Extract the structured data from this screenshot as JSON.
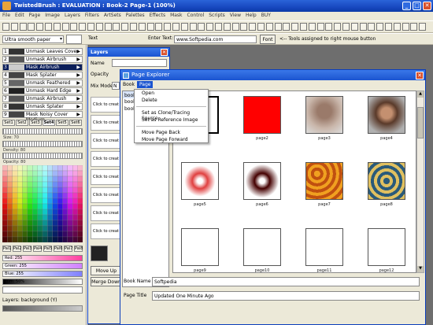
{
  "app": {
    "title": "TwistedBrush : EVALUATION : Book-2 Page-1 (100%)",
    "minimize": "_",
    "maximize": "□",
    "close": "✕"
  },
  "menubar": [
    "File",
    "Edit",
    "Page",
    "Image",
    "Layers",
    "Filters",
    "ArtSets",
    "Palettes",
    "Effects",
    "Mask",
    "Control",
    "Scripts",
    "View",
    "Help",
    "BUY"
  ],
  "toolbar2": {
    "paper": "Ultra smooth paper",
    "text_btn": "Text",
    "enter_text_label": "Enter Text:",
    "enter_text_value": "www.Softpedia.com",
    "font_btn": "Font",
    "hint": "<-- Tools assigned to right mouse button"
  },
  "brushes": [
    {
      "num": "1",
      "label": "Unmask Leaves Cover"
    },
    {
      "num": "2",
      "label": "Unmask Airbrush"
    },
    {
      "num": "3",
      "label": "Mask Airbrush"
    },
    {
      "num": "4",
      "label": "Mask Splater"
    },
    {
      "num": "5",
      "label": "Unmask Feathered"
    },
    {
      "num": "6",
      "label": "Unmask Hard Edge"
    },
    {
      "num": "7",
      "label": "Unmask Airbrush"
    },
    {
      "num": "8",
      "label": "Unmask Splater"
    },
    {
      "num": "9",
      "label": "Mask Noisy Cover Medium"
    }
  ],
  "sets": [
    "Set1",
    "Set2",
    "Set3",
    "Set4",
    "Set5",
    "Set6"
  ],
  "sliders": {
    "size": "Size: 70",
    "density": "Density: 80",
    "opacity": "Opacity: 80"
  },
  "pal_buttons": [
    "Pal1",
    "Pal2",
    "Pal3",
    "Pal4",
    "Pal5",
    "Pal6",
    "Pal7",
    "Pal8"
  ],
  "color_bars": {
    "red": "Red: 255",
    "green": "Green: 255",
    "blue": "Blue: 255",
    "lum": "Lum: 50%"
  },
  "layers_label": "Layers: background (Y)",
  "layers_panel": {
    "title": "Layers",
    "close": "✕",
    "name_label": "Name",
    "opacity_label": "Opacity",
    "mix_label": "Mix Mode",
    "mix_value": "N",
    "click_text": "Click to creat",
    "move_up": "Move Up",
    "merge_down": "Merge Down"
  },
  "page_explorer": {
    "title": "Page Explorer",
    "close": "✕",
    "menu": [
      "Book",
      "Page"
    ],
    "book_list": [
      "book",
      "book",
      "book"
    ],
    "book_name_label": "Book Name",
    "book_name_value": "Softpedia",
    "page_title_label": "Page Title",
    "page_title_value": "Updated One Minute Ago",
    "pages": [
      "page1",
      "page2",
      "page3",
      "page4",
      "page5",
      "page6",
      "page7",
      "page8",
      "page9",
      "page10",
      "page11",
      "page12"
    ]
  },
  "dropdown": [
    {
      "label": "Open"
    },
    {
      "label": "Delete"
    },
    {
      "sep": true
    },
    {
      "label": "Set as Clone/Tracing Source"
    },
    {
      "label": "Set as Reference Image"
    },
    {
      "sep": true
    },
    {
      "label": "Move Page Back"
    },
    {
      "label": "Move Page Forward"
    }
  ],
  "colors": {
    "accent": "#1b54d0",
    "page2": "#ff0000"
  }
}
